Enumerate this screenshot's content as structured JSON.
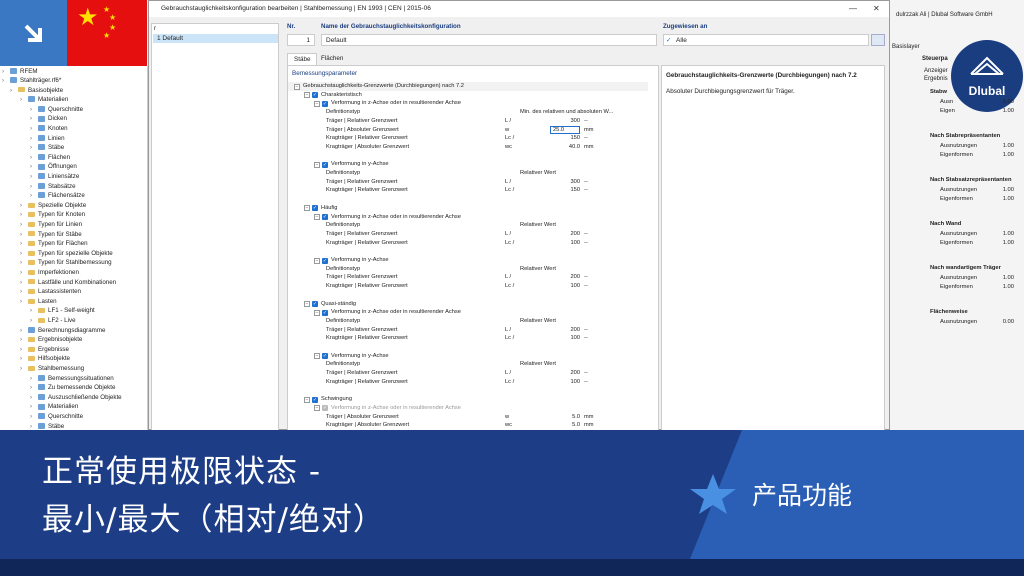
{
  "app": {
    "titlebar_fragment": "dulrzzak Ali | Dlubal Software GmbH",
    "basislayer": "Basislayer",
    "steuerpanel": "Steuerpa",
    "anzeige": "Anzeiger",
    "ergebnis": "Ergebnis"
  },
  "tree": {
    "root": "RFEM",
    "file": "Stahlträger.rf6*",
    "items": [
      "Basisobjekte",
      "Materialien",
      "Querschnitte",
      "Dicken",
      "Knoten",
      "Linien",
      "Stäbe",
      "Flächen",
      "Öffnungen",
      "Liniensätze",
      "Stabsätze",
      "Flächensätze",
      "Spezielle Objekte",
      "Typen für Knoten",
      "Typen für Linien",
      "Typen für Stäbe",
      "Typen für Flächen",
      "Typen für spezielle Objekte",
      "Typen für Stahlbemessung",
      "Imperfektionen",
      "Lastfälle und Kombinationen",
      "Lastassistenten",
      "Lasten",
      "LF1 - Self-weight",
      "LF2 - Live",
      "Berechnungsdiagramme",
      "Ergebnisobjekte",
      "Ergebnisse",
      "Hilfsobjekte",
      "Stahlbemessung",
      "Bemessungssituationen",
      "Zu bemessende Objekte",
      "Auszuschließende Objekte",
      "Materialien",
      "Querschnitte",
      "Stäbe"
    ]
  },
  "dialog": {
    "title": "Gebrauchstauglichkeitskonfiguration bearbeiten | Stahlbemessung | EN 1993 | CEN | 2015-06",
    "list_header": "r",
    "list_item": "1  Default",
    "nr_label": "Nr.",
    "nr_value": "1",
    "name_label": "Name der Gebrauchstauglichkeitskonfiguration",
    "name_value": "Default",
    "assigned_label": "Zugewiesen an",
    "assigned_value": "Alle",
    "tabs": [
      "Stäbe",
      "Flächen"
    ],
    "section": "Bemessungsparameter",
    "info_title": "Gebrauchstauglichkeits-Grenzwerte (Durchbiegungen) nach 7.2",
    "info_desc": "Absoluter Durchbiegungsgrenzwert für Träger."
  },
  "grid": [
    {
      "t": "Gebrauchstauglichkeits-Grenzwerte (Durchbiegungen) nach 7.2",
      "lvl": 0,
      "kind": "group"
    },
    {
      "t": "Charakteristisch",
      "lvl": 1,
      "kind": "check"
    },
    {
      "t": "Verformung in z-Achse oder in resultierender Achse",
      "lvl": 2,
      "kind": "check"
    },
    {
      "t": "Definitionstyp",
      "lvl": 3,
      "val": "Min. des relativen und absoluten W..."
    },
    {
      "t": "Träger | Relativer Grenzwert",
      "lvl": 3,
      "sym": "L /",
      "val": "300",
      "unit": "--"
    },
    {
      "t": "Träger | Absoluter Grenzwert",
      "lvl": 3,
      "sym": "w",
      "val": "25.0",
      "unit": "mm",
      "edit": true
    },
    {
      "t": "Kragträger | Relativer Grenzwert",
      "lvl": 3,
      "sym": "Lc /",
      "val": "150",
      "unit": "--"
    },
    {
      "t": "Kragträger | Absoluter Grenzwert",
      "lvl": 3,
      "sym": "wc",
      "val": "40.0",
      "unit": "mm"
    },
    {
      "t": "",
      "lvl": 0,
      "kind": "blank"
    },
    {
      "t": "Verformung in y-Achse",
      "lvl": 2,
      "kind": "check"
    },
    {
      "t": "Definitionstyp",
      "lvl": 3,
      "val": "Relativer Wert"
    },
    {
      "t": "Träger | Relativer Grenzwert",
      "lvl": 3,
      "sym": "L /",
      "val": "300",
      "unit": "--"
    },
    {
      "t": "Kragträger | Relativer Grenzwert",
      "lvl": 3,
      "sym": "Lc /",
      "val": "150",
      "unit": "--"
    },
    {
      "t": "",
      "lvl": 0,
      "kind": "blank"
    },
    {
      "t": "Häufig",
      "lvl": 1,
      "kind": "check"
    },
    {
      "t": "Verformung in z-Achse oder in resultierender Achse",
      "lvl": 2,
      "kind": "check"
    },
    {
      "t": "Definitionstyp",
      "lvl": 3,
      "val": "Relativer Wert"
    },
    {
      "t": "Träger | Relativer Grenzwert",
      "lvl": 3,
      "sym": "L /",
      "val": "200",
      "unit": "--"
    },
    {
      "t": "Kragträger | Relativer Grenzwert",
      "lvl": 3,
      "sym": "Lc /",
      "val": "100",
      "unit": "--"
    },
    {
      "t": "",
      "lvl": 0,
      "kind": "blank"
    },
    {
      "t": "Verformung in y-Achse",
      "lvl": 2,
      "kind": "check"
    },
    {
      "t": "Definitionstyp",
      "lvl": 3,
      "val": "Relativer Wert"
    },
    {
      "t": "Träger | Relativer Grenzwert",
      "lvl": 3,
      "sym": "L /",
      "val": "200",
      "unit": "--"
    },
    {
      "t": "Kragträger | Relativer Grenzwert",
      "lvl": 3,
      "sym": "Lc /",
      "val": "100",
      "unit": "--"
    },
    {
      "t": "",
      "lvl": 0,
      "kind": "blank"
    },
    {
      "t": "Quasi-ständig",
      "lvl": 1,
      "kind": "check"
    },
    {
      "t": "Verformung in z-Achse oder in resultierender Achse",
      "lvl": 2,
      "kind": "check"
    },
    {
      "t": "Definitionstyp",
      "lvl": 3,
      "val": "Relativer Wert"
    },
    {
      "t": "Träger | Relativer Grenzwert",
      "lvl": 3,
      "sym": "L /",
      "val": "200",
      "unit": "--"
    },
    {
      "t": "Kragträger | Relativer Grenzwert",
      "lvl": 3,
      "sym": "Lc /",
      "val": "100",
      "unit": "--"
    },
    {
      "t": "",
      "lvl": 0,
      "kind": "blank"
    },
    {
      "t": "Verformung in y-Achse",
      "lvl": 2,
      "kind": "check"
    },
    {
      "t": "Definitionstyp",
      "lvl": 3,
      "val": "Relativer Wert"
    },
    {
      "t": "Träger | Relativer Grenzwert",
      "lvl": 3,
      "sym": "L /",
      "val": "200",
      "unit": "--"
    },
    {
      "t": "Kragträger | Relativer Grenzwert",
      "lvl": 3,
      "sym": "Lc /",
      "val": "100",
      "unit": "--"
    },
    {
      "t": "",
      "lvl": 0,
      "kind": "blank"
    },
    {
      "t": "Schwingung",
      "lvl": 1,
      "kind": "check"
    },
    {
      "t": "Verformung in z-Achse oder in resultierender Achse",
      "lvl": 2,
      "kind": "checkgray"
    },
    {
      "t": "Träger | Absoluter Grenzwert",
      "lvl": 3,
      "sym": "w",
      "val": "5.0",
      "unit": "mm"
    },
    {
      "t": "Kragträger | Absoluter Grenzwert",
      "lvl": 3,
      "sym": "wc",
      "val": "5.0",
      "unit": "mm"
    }
  ],
  "right_panel": [
    {
      "h": "Stabw",
      "rows": [
        [
          "Ausn",
          "1.00"
        ],
        [
          "Eigen",
          "1.00"
        ]
      ]
    },
    {
      "h": "Nach Stabrepräsentanten",
      "rows": [
        [
          "Ausnutzungen",
          "1.00"
        ],
        [
          "Eigenformen",
          "1.00"
        ]
      ]
    },
    {
      "h": "Nach Stabsatzrepräsentanten",
      "rows": [
        [
          "Ausnutzungen",
          "1.00"
        ],
        [
          "Eigenformen",
          "1.00"
        ]
      ]
    },
    {
      "h": "Nach Wand",
      "rows": [
        [
          "Ausnutzungen",
          "1.00"
        ],
        [
          "Eigenformen",
          "1.00"
        ]
      ]
    },
    {
      "h": "Nach wandartigem Träger",
      "rows": [
        [
          "Ausnutzungen",
          "1.00"
        ],
        [
          "Eigenformen",
          "1.00"
        ]
      ]
    },
    {
      "h": "Flächenweise",
      "rows": [
        [
          "Ausnutzungen",
          "0.00"
        ]
      ]
    }
  ],
  "brand": {
    "name": "Dlubal"
  },
  "banner": {
    "title_line1": "正常使用极限状态 -",
    "title_line2": "最小/最大（相对/绝对）",
    "feature": "产品功能"
  },
  "colors": {
    "banner": "#1d3e87",
    "accent": "#2a5fb5",
    "strip": "#102659"
  }
}
